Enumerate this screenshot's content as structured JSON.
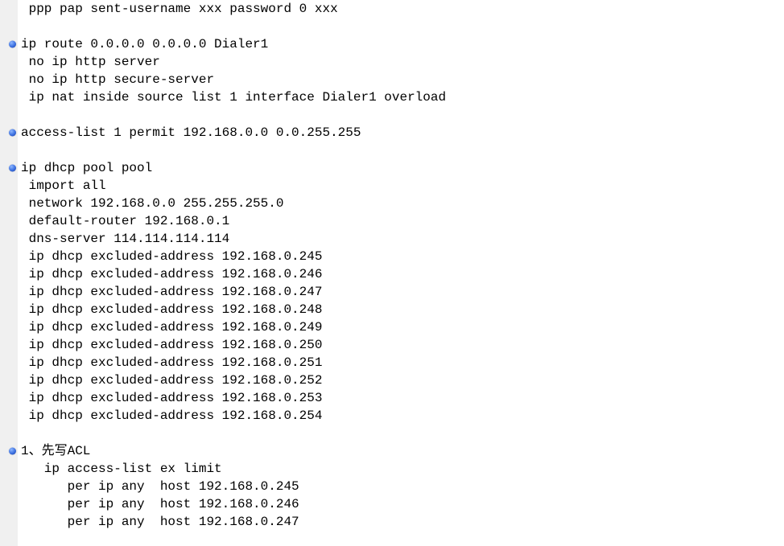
{
  "lines": [
    {
      "text": " ppp pap sent-username xxx password 0 xxx",
      "marker": false
    },
    {
      "text": "",
      "marker": false
    },
    {
      "text": "ip route 0.0.0.0 0.0.0.0 Dialer1",
      "marker": true
    },
    {
      "text": " no ip http server",
      "marker": false
    },
    {
      "text": " no ip http secure-server",
      "marker": false
    },
    {
      "text": " ip nat inside source list 1 interface Dialer1 overload",
      "marker": false
    },
    {
      "text": "",
      "marker": false
    },
    {
      "text": "access-list 1 permit 192.168.0.0 0.0.255.255",
      "marker": true
    },
    {
      "text": "",
      "marker": false
    },
    {
      "text": "ip dhcp pool pool",
      "marker": true
    },
    {
      "text": " import all",
      "marker": false
    },
    {
      "text": " network 192.168.0.0 255.255.255.0",
      "marker": false
    },
    {
      "text": " default-router 192.168.0.1",
      "marker": false
    },
    {
      "text": " dns-server 114.114.114.114",
      "marker": false
    },
    {
      "text": " ip dhcp excluded-address 192.168.0.245",
      "marker": false
    },
    {
      "text": " ip dhcp excluded-address 192.168.0.246",
      "marker": false
    },
    {
      "text": " ip dhcp excluded-address 192.168.0.247",
      "marker": false
    },
    {
      "text": " ip dhcp excluded-address 192.168.0.248",
      "marker": false
    },
    {
      "text": " ip dhcp excluded-address 192.168.0.249",
      "marker": false
    },
    {
      "text": " ip dhcp excluded-address 192.168.0.250",
      "marker": false
    },
    {
      "text": " ip dhcp excluded-address 192.168.0.251",
      "marker": false
    },
    {
      "text": " ip dhcp excluded-address 192.168.0.252",
      "marker": false
    },
    {
      "text": " ip dhcp excluded-address 192.168.0.253",
      "marker": false
    },
    {
      "text": " ip dhcp excluded-address 192.168.0.254",
      "marker": false
    },
    {
      "text": "",
      "marker": false
    },
    {
      "text": "1、先写ACL",
      "marker": true
    },
    {
      "text": "   ip access-list ex limit",
      "marker": false
    },
    {
      "text": "      per ip any  host 192.168.0.245",
      "marker": false
    },
    {
      "text": "      per ip any  host 192.168.0.246",
      "marker": false
    },
    {
      "text": "      per ip any  host 192.168.0.247",
      "marker": false
    }
  ]
}
